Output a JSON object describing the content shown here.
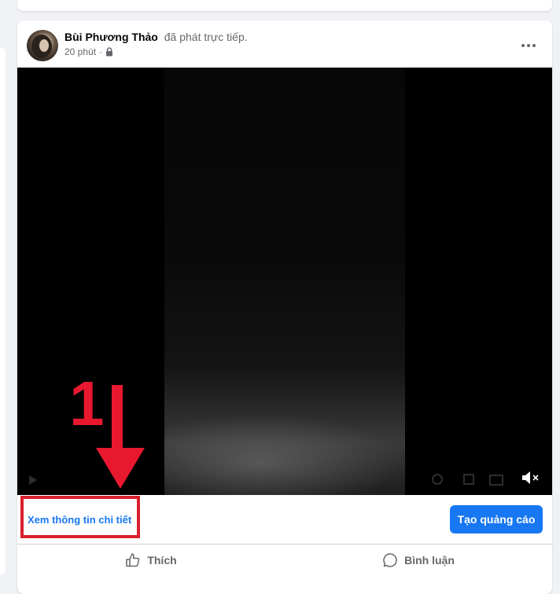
{
  "post": {
    "author": "Bùi Phương Thảo",
    "action": "đã phát trực tiếp.",
    "time": "20 phút",
    "separator": "·",
    "privacy_icon": "lock-icon",
    "more_icon": "more-icon"
  },
  "video": {
    "volume_icon": "volume-muted-icon"
  },
  "cta": {
    "details_link": "Xem thông tin chi tiết",
    "ad_button": "Tạo quảng cáo"
  },
  "actions": {
    "like": "Thích",
    "comment": "Bình luận"
  },
  "annotation": {
    "number": "1",
    "color": "#e8182f"
  },
  "colors": {
    "brand": "#1877f2",
    "highlight": "#d9202c"
  }
}
